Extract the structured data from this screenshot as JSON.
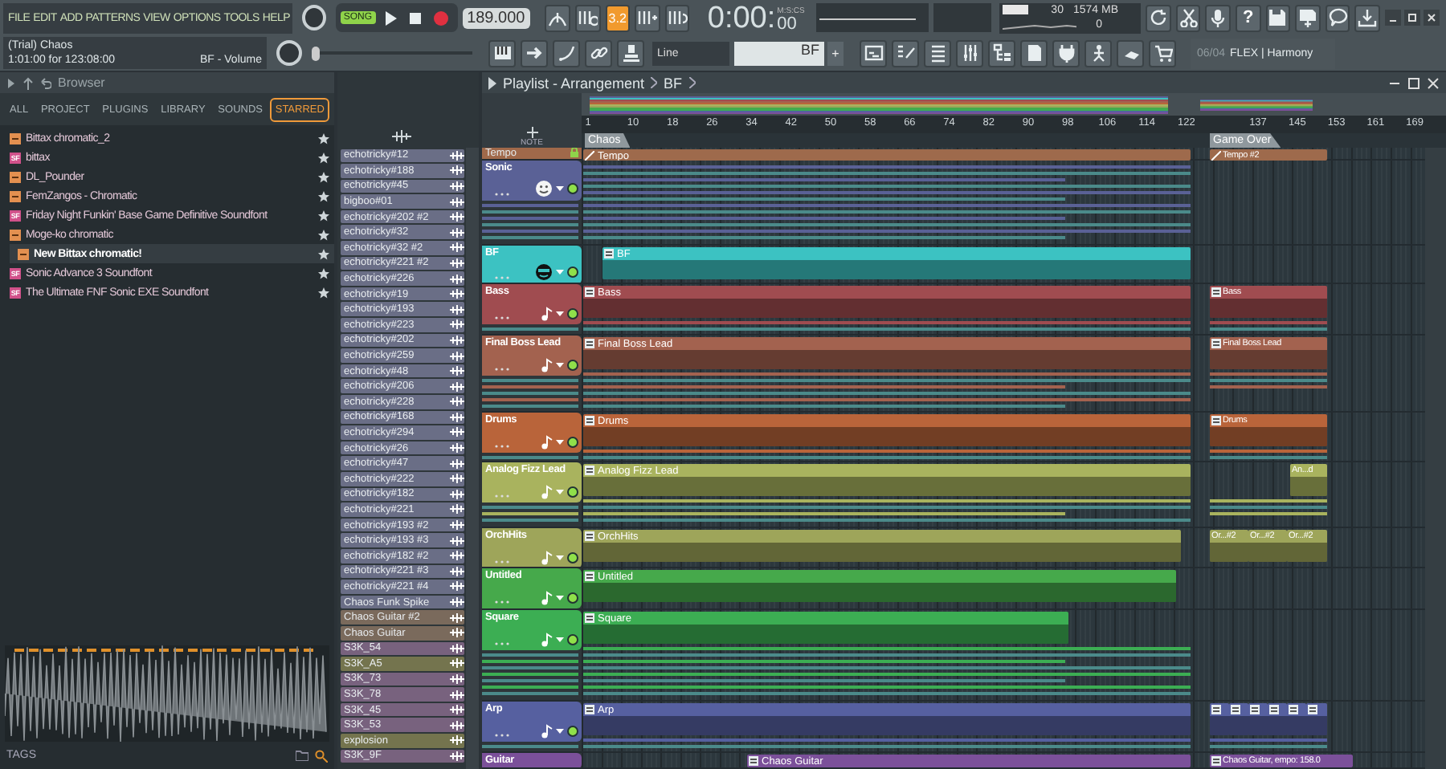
{
  "menu": [
    "FILE",
    "EDIT",
    "ADD",
    "PATTERNS",
    "VIEW",
    "OPTIONS",
    "TOOLS",
    "HELP"
  ],
  "hint": {
    "title": "(Trial) Chaos",
    "detail": "1:01:00 for 123:08:00",
    "target": "BF - Volume"
  },
  "transport": {
    "mode_label": "SONG",
    "song_mode": true,
    "tempo": "189.000"
  },
  "precount": {
    "label": "3.2",
    "on": true
  },
  "time": {
    "unit": "M:S:CS",
    "value": "0:00:",
    "centiseconds": "00"
  },
  "monitor": {
    "cpu": "30",
    "memory": "1574 MB",
    "polyphony": "0"
  },
  "help": {
    "label": "?"
  },
  "master_pitch": {
    "level": 0
  },
  "snap": {
    "value": "Line"
  },
  "pattern_selector": {
    "value": "BF",
    "add": "+"
  },
  "news": {
    "date": "06/04",
    "title": "FLEX | Harmony"
  },
  "browser": {
    "title": "Browser",
    "tabs": [
      {
        "label": "ALL",
        "selected": false
      },
      {
        "label": "PROJECT",
        "selected": false
      },
      {
        "label": "PLUGINS",
        "selected": false
      },
      {
        "label": "LIBRARY",
        "selected": false
      },
      {
        "label": "SOUNDS",
        "selected": false
      },
      {
        "label": "STARRED",
        "selected": true
      }
    ],
    "items": [
      {
        "name": "Bittax chromatic_2",
        "kind": "preset",
        "selected": false
      },
      {
        "name": "bittax",
        "kind": "soundfont",
        "badge": "SF",
        "selected": false
      },
      {
        "name": "DL_Pounder",
        "kind": "preset",
        "selected": false
      },
      {
        "name": "FemZangos - Chromatic",
        "kind": "preset",
        "selected": false
      },
      {
        "name": "Friday Night Funkin' Base Game Definitive Soundfont",
        "kind": "soundfont",
        "badge": "SF",
        "selected": false
      },
      {
        "name": "Moge-ko chromatic",
        "kind": "preset",
        "selected": false
      },
      {
        "name": "New Bittax chromatic!",
        "kind": "preset",
        "selected": true
      },
      {
        "name": "Sonic Advance 3 Soundfont",
        "kind": "soundfont",
        "badge": "SF",
        "selected": false
      },
      {
        "name": "The Ultimate FNF Sonic EXE Soundfont",
        "kind": "soundfont",
        "badge": "SF",
        "selected": false
      }
    ],
    "tags_label": "TAGS"
  },
  "patterns": [
    {
      "name": "echotricky#12",
      "color": "#6a6e86"
    },
    {
      "name": "echotricky#188",
      "color": "#6a6e86"
    },
    {
      "name": "echotricky#45",
      "color": "#6a6e86"
    },
    {
      "name": "bigboo#01",
      "color": "#6a6e86"
    },
    {
      "name": "echotricky#202 #2",
      "color": "#6a6e86"
    },
    {
      "name": "echotricky#32",
      "color": "#6a6e86"
    },
    {
      "name": "echotricky#32 #2",
      "color": "#6a6e86"
    },
    {
      "name": "echotricky#221 #2",
      "color": "#6a6e86"
    },
    {
      "name": "echotricky#226",
      "color": "#6a6e86"
    },
    {
      "name": "echotricky#19",
      "color": "#6a6e86"
    },
    {
      "name": "echotricky#193",
      "color": "#6a6e86"
    },
    {
      "name": "echotricky#223",
      "color": "#6a6e86"
    },
    {
      "name": "echotricky#202",
      "color": "#6a6e86"
    },
    {
      "name": "echotricky#259",
      "color": "#6a6e86"
    },
    {
      "name": "echotricky#48",
      "color": "#6a6e86"
    },
    {
      "name": "echotricky#206",
      "color": "#6a6e86"
    },
    {
      "name": "echotricky#228",
      "color": "#6a6e86"
    },
    {
      "name": "echotricky#168",
      "color": "#6a6e86"
    },
    {
      "name": "echotricky#294",
      "color": "#6a6e86"
    },
    {
      "name": "echotricky#26",
      "color": "#6a6e86"
    },
    {
      "name": "echotricky#47",
      "color": "#6a6e86"
    },
    {
      "name": "echotricky#222",
      "color": "#6a6e86"
    },
    {
      "name": "echotricky#182",
      "color": "#6a6e86"
    },
    {
      "name": "echotricky#221",
      "color": "#6a6e86"
    },
    {
      "name": "echotricky#193 #2",
      "color": "#6a6e86"
    },
    {
      "name": "echotricky#193 #3",
      "color": "#6a6e86"
    },
    {
      "name": "echotricky#182 #2",
      "color": "#6a6e86"
    },
    {
      "name": "echotricky#221 #3",
      "color": "#6a6e86"
    },
    {
      "name": "echotricky#221 #4",
      "color": "#6a6e86"
    },
    {
      "name": "Chaos Funk Spike",
      "color": "#6a6e86"
    },
    {
      "name": "Chaos Guitar #2",
      "color": "#7a6a5c"
    },
    {
      "name": "Chaos Guitar",
      "color": "#7a6a5c"
    },
    {
      "name": "S3K_54",
      "color": "#78627e"
    },
    {
      "name": "S3K_A5",
      "color": "#74744e"
    },
    {
      "name": "S3K_73",
      "color": "#78627e"
    },
    {
      "name": "S3K_78",
      "color": "#78627e"
    },
    {
      "name": "S3K_45",
      "color": "#78627e"
    },
    {
      "name": "S3K_53",
      "color": "#78627e"
    },
    {
      "name": "explosion",
      "color": "#74744e"
    },
    {
      "name": "S3K_9F",
      "color": "#78627e"
    }
  ],
  "playlist": {
    "title": "Playlist - Arrangement",
    "breadcrumb": "BF",
    "corner_label": "NOTE",
    "ruler": [
      "1",
      "10",
      "18",
      "26",
      "34",
      "42",
      "50",
      "58",
      "66",
      "74",
      "82",
      "90",
      "98",
      "106",
      "114",
      "122",
      "137",
      "145",
      "153",
      "161",
      "169"
    ],
    "markers": [
      {
        "label": "Chaos"
      },
      {
        "label": "Game Over"
      }
    ],
    "tempo_track": {
      "name": "Tempo",
      "clips": [
        {
          "label": "Tempo"
        },
        {
          "label": "Tempo #2"
        }
      ]
    },
    "tracks": [
      {
        "name": "Sonic",
        "kind": "smiley",
        "color": "#5a6196"
      },
      {
        "name": "BF",
        "kind": "sunglasses",
        "color": "#3cc2c2",
        "clips": [
          {
            "label": "BF"
          }
        ]
      },
      {
        "name": "Bass",
        "kind": "note",
        "color": "#a04c50",
        "clips": [
          {
            "label": "Bass"
          },
          {
            "label": "Bass"
          }
        ]
      },
      {
        "name": "Final Boss Lead",
        "kind": "note",
        "color": "#a3624f",
        "clips": [
          {
            "label": "Final Boss Lead"
          },
          {
            "label": "Final Boss Lead"
          }
        ]
      },
      {
        "name": "Drums",
        "kind": "note",
        "color": "#b9643a",
        "clips": [
          {
            "label": "Drums"
          },
          {
            "label": "Drums"
          }
        ]
      },
      {
        "name": "Analog Fizz Lead",
        "kind": "note",
        "color": "#a9b35e",
        "clips": [
          {
            "label": "Analog Fizz Lead"
          },
          {
            "label": "An...d"
          }
        ]
      },
      {
        "name": "OrchHits",
        "kind": "note",
        "color": "#9ea55a",
        "clips": [
          {
            "label": "OrchHits"
          },
          {
            "label": "Or...#2"
          },
          {
            "label": "Or...#2"
          },
          {
            "label": "Or...#2"
          }
        ]
      },
      {
        "name": "Untitled",
        "kind": "note",
        "color": "#46a94b",
        "clips": [
          {
            "label": "Untitled"
          }
        ]
      },
      {
        "name": "Square",
        "kind": "note",
        "color": "#3cae53",
        "clips": [
          {
            "label": "Square"
          }
        ]
      },
      {
        "name": "Arp",
        "kind": "note",
        "color": "#5660a0",
        "clips": [
          {
            "label": "Arp"
          }
        ]
      },
      {
        "name": "Guitar",
        "kind": "plain",
        "color": "#7b509a",
        "clips": [
          {
            "label": "Chaos Guitar"
          },
          {
            "label": "Chaos Guitar, empo: 158.0"
          }
        ]
      }
    ]
  }
}
